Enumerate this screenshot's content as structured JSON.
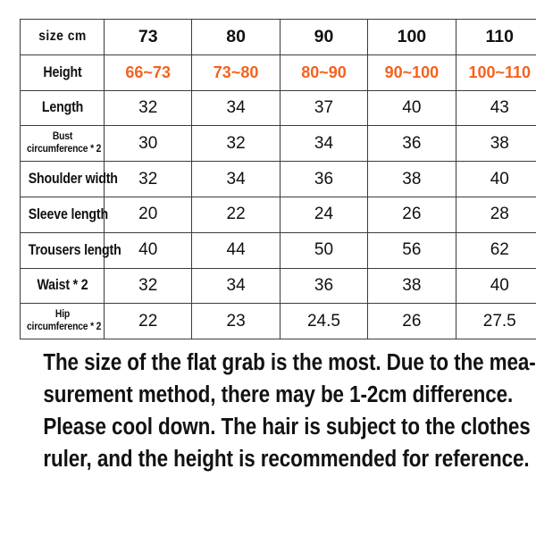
{
  "table": {
    "header": {
      "label": "size  cm",
      "sizes": [
        "73",
        "80",
        "90",
        "100",
        "110"
      ]
    },
    "rows": [
      {
        "label": "Height",
        "label_lines": [
          "Height"
        ],
        "style": "height",
        "values": [
          "66~73",
          "73~80",
          "80~90",
          "90~100",
          "100~110"
        ]
      },
      {
        "label": "Length",
        "label_lines": [
          "Length"
        ],
        "style": "normal",
        "values": [
          "32",
          "34",
          "37",
          "40",
          "43"
        ]
      },
      {
        "label": "Bust circumference * 2",
        "label_lines": [
          "Bust",
          "circumference * 2"
        ],
        "style": "small",
        "values": [
          "30",
          "32",
          "34",
          "36",
          "38"
        ]
      },
      {
        "label": "Shoulder width",
        "label_lines": [
          "Shoulder width"
        ],
        "style": "normal",
        "values": [
          "32",
          "34",
          "36",
          "38",
          "40"
        ]
      },
      {
        "label": "Sleeve length",
        "label_lines": [
          "Sleeve length"
        ],
        "style": "normal",
        "values": [
          "20",
          "22",
          "24",
          "26",
          "28"
        ]
      },
      {
        "label": "Trousers length",
        "label_lines": [
          "Trousers length"
        ],
        "style": "normal",
        "values": [
          "40",
          "44",
          "50",
          "56",
          "62"
        ]
      },
      {
        "label": "Waist * 2",
        "label_lines": [
          "Waist * 2"
        ],
        "style": "normal",
        "values": [
          "32",
          "34",
          "36",
          "38",
          "40"
        ]
      },
      {
        "label": "Hip circumference * 2",
        "label_lines": [
          "Hip",
          "circumference * 2"
        ],
        "style": "small",
        "values": [
          "22",
          "23",
          "24.5",
          "26",
          "27.5"
        ]
      }
    ]
  },
  "note": {
    "lines": [
      "The size of the flat grab is the most. Due to the mea-",
      "surement method, there may be 1-2cm difference.",
      "Please cool down. The hair is subject to the clothes",
      "ruler, and the height is recommended for reference."
    ]
  },
  "colors": {
    "height_orange": "#F4621E",
    "text": "#121212",
    "border": "#3b3b3b",
    "background": "#ffffff"
  }
}
